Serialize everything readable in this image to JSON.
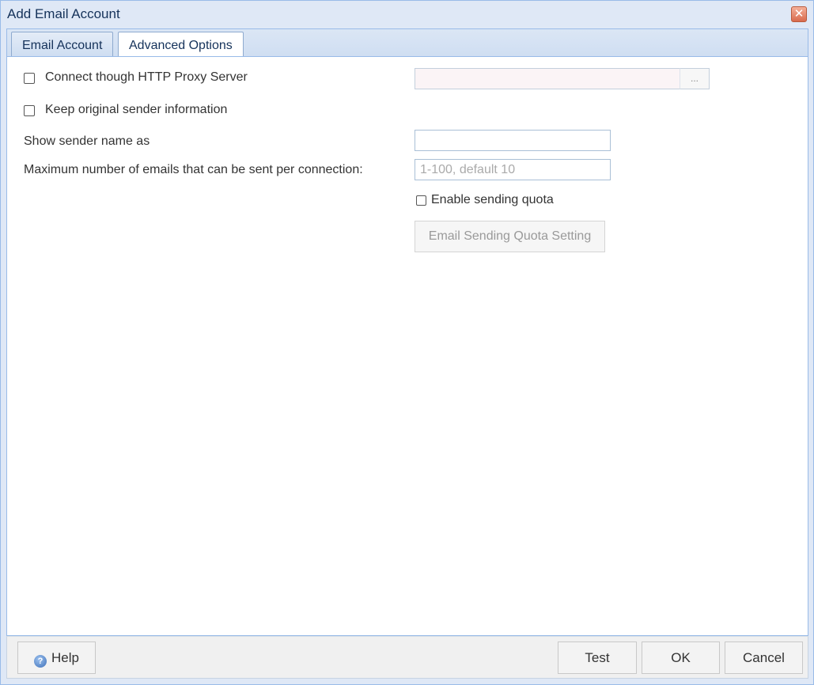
{
  "window": {
    "title": "Add Email Account",
    "close_glyph": "✕"
  },
  "tabs": [
    {
      "label": "Email Account",
      "active": false
    },
    {
      "label": "Advanced Options",
      "active": true
    }
  ],
  "form": {
    "proxy": {
      "label": "Connect though HTTP Proxy Server",
      "checked": false,
      "value": "",
      "browse_label": "..."
    },
    "keep_sender": {
      "label": "Keep original sender information",
      "checked": false
    },
    "sender_name": {
      "label": "Show sender name as",
      "value": ""
    },
    "max_emails": {
      "label": "Maximum number of emails that can be sent per connection:",
      "value": "",
      "placeholder": "1-100, default 10"
    },
    "sending_quota": {
      "label": "Enable sending quota",
      "checked": false
    },
    "quota_button": {
      "label": "Email Sending Quota Setting",
      "enabled": false
    }
  },
  "footer": {
    "help_label": "Help",
    "help_icon": "help-icon",
    "test_label": "Test",
    "ok_label": "OK",
    "cancel_label": "Cancel"
  }
}
